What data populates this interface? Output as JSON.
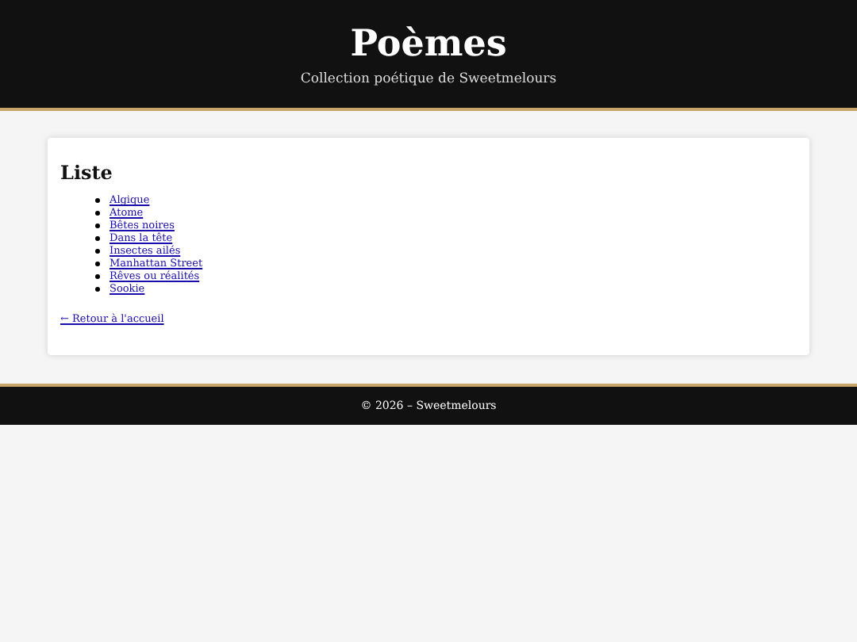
{
  "header": {
    "title": "Poèmes",
    "subtitle": "Collection poétique de Sweetmelours"
  },
  "card": {
    "heading": "Liste",
    "items": [
      {
        "label": "Algique"
      },
      {
        "label": "Atome"
      },
      {
        "label": "Bêtes noires"
      },
      {
        "label": "Dans la tête"
      },
      {
        "label": "Insectes ailés"
      },
      {
        "label": "Manhattan Street"
      },
      {
        "label": "Rêves ou réalités"
      },
      {
        "label": "Sookie"
      }
    ],
    "back_link": "← Retour à l'accueil"
  },
  "footer": {
    "text": "© 2026 – Sweetmelours"
  }
}
